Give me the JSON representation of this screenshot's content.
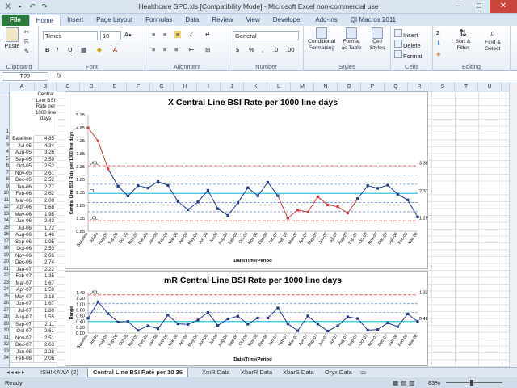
{
  "window": {
    "title": "Healthcare SPC.xls  [Compatibility Mode]  -  Microsoft Excel non-commercial use"
  },
  "tabs": [
    "File",
    "Home",
    "Insert",
    "Page Layout",
    "Formulas",
    "Data",
    "Review",
    "View",
    "Developer",
    "Add-Ins",
    "QI Macros 2011"
  ],
  "ribbon": {
    "paste": "Paste",
    "clipboard": "Clipboard",
    "font_name": "Times",
    "font_size": "10",
    "font": "Font",
    "alignment": "Alignment",
    "number_format": "General",
    "number": "Number",
    "cond_fmt": "Conditional Formatting",
    "format_table": "Format as Table",
    "cell_styles": "Cell Styles",
    "styles": "Styles",
    "insert": "Insert",
    "delete": "Delete",
    "format": "Format",
    "cells": "Cells",
    "sort_filter": "Sort & Filter",
    "find_select": "Find & Select",
    "editing": "Editing",
    "currency": "$",
    "percent": "%",
    "comma": ",",
    "dec_inc": ".0",
    "dec_dec": ".00"
  },
  "formula": {
    "namebox": "T22",
    "fx": "fx"
  },
  "columns": [
    "A",
    "B",
    "C",
    "D",
    "E",
    "F",
    "G",
    "H",
    "I",
    "J",
    "K",
    "L",
    "M",
    "N",
    "O",
    "P",
    "Q",
    "R",
    "S",
    "T",
    "U"
  ],
  "colB_header": "Central Line BSI Rate per 1000 line days",
  "rows": [
    [
      "Baseline",
      "4.85"
    ],
    [
      "Jul-05",
      "4.34"
    ],
    [
      "Aug-05",
      "3.26"
    ],
    [
      "Sep-05",
      "2.59"
    ],
    [
      "Oct-05",
      "2.52"
    ],
    [
      "Nov-05",
      "2.61"
    ],
    [
      "Dec-05",
      "2.52"
    ],
    [
      "Jan-06",
      "2.77"
    ],
    [
      "Feb-06",
      "2.62"
    ],
    [
      "Mar-06",
      "2.00"
    ],
    [
      "Apr-06",
      "1.68"
    ],
    [
      "May-06",
      "1.98"
    ],
    [
      "Jun-06",
      "2.43"
    ],
    [
      "Jul-06",
      "1.72"
    ],
    [
      "Aug-06",
      "1.46"
    ],
    [
      "Sep-06",
      "1.95"
    ],
    [
      "Oct-06",
      "2.53"
    ],
    [
      "Nov-06",
      "2.06"
    ],
    [
      "Dec-06",
      "2.74"
    ],
    [
      "Jan-07",
      "2.22"
    ],
    [
      "Feb-07",
      "1.35"
    ],
    [
      "Mar-07",
      "1.67"
    ],
    [
      "Apr-07",
      "1.59"
    ],
    [
      "May-07",
      "2.18"
    ],
    [
      "Jun-07",
      "1.67"
    ],
    [
      "Jul-07",
      "1.80"
    ],
    [
      "Aug-07",
      "1.55"
    ],
    [
      "Sep-07",
      "2.11"
    ],
    [
      "Oct-07",
      "2.61"
    ],
    [
      "Nov-07",
      "2.51"
    ],
    [
      "Dec-07",
      "2.63"
    ],
    [
      "Jan-08",
      "2.28"
    ],
    [
      "Feb-08",
      "2.06"
    ]
  ],
  "chart_data": [
    {
      "type": "line",
      "title": "X Central Line BSI Rate per 1000 line days",
      "xlabel": "Date/Time/Period",
      "ylabel": "Central Line BSI Rate per 1000 line days",
      "categories": [
        "Baseline",
        "Jul-05",
        "Aug-05",
        "Sep-05",
        "Oct-05",
        "Nov-05",
        "Dec-05",
        "Jan-06",
        "Feb-06",
        "Mar-06",
        "Apr-06",
        "May-06",
        "Jun-06",
        "Jul-06",
        "Aug-06",
        "Sep-06",
        "Oct-06",
        "Nov-06",
        "Dec-06",
        "Jan-07",
        "Feb-07",
        "Mar-07",
        "Apr-07",
        "May-07",
        "Jun-07",
        "Jul-07",
        "Aug-07",
        "Sep-07",
        "Oct-07",
        "Nov-07",
        "Dec-07",
        "Jan-08",
        "Feb-08",
        "Mar-08"
      ],
      "values": [
        4.85,
        4.34,
        3.26,
        2.59,
        2.21,
        2.61,
        2.52,
        2.77,
        2.62,
        2.0,
        1.68,
        1.98,
        2.43,
        1.72,
        1.46,
        1.95,
        2.53,
        2.22,
        2.74,
        2.22,
        1.35,
        1.67,
        1.59,
        2.18,
        1.87,
        1.8,
        1.55,
        2.11,
        2.61,
        2.51,
        2.63,
        2.28,
        2.06,
        1.4
      ],
      "yticks": [
        "0.85",
        "1.35",
        "1.85",
        "2.35",
        "2.85",
        "3.35",
        "3.85",
        "4.35",
        "4.85",
        "5.35"
      ],
      "ylim": [
        0.85,
        5.35
      ],
      "ucl": 3.38,
      "cl": 2.31,
      "lcl": 1.25,
      "ucl_label": "UCL",
      "cl_label": "CL",
      "lcl_label": "LCL",
      "ucl_text": "3.38",
      "cl_text": "2.31",
      "lcl_text": "1.25"
    },
    {
      "type": "line",
      "title": "mR Central Line BSI Rate per 1000 line days",
      "xlabel": "Date/Time/Period",
      "ylabel": "Range",
      "categories": [
        "Baseline",
        "Jul-05",
        "Aug-05",
        "Sep-05",
        "Oct-05",
        "Nov-05",
        "Dec-05",
        "Jan-06",
        "Feb-06",
        "Mar-06",
        "Apr-06",
        "May-06",
        "Jun-06",
        "Jul-06",
        "Aug-06",
        "Sep-06",
        "Oct-06",
        "Nov-06",
        "Dec-06",
        "Jan-07",
        "Feb-07",
        "Mar-07",
        "Apr-07",
        "May-07",
        "Jun-07",
        "Jul-07",
        "Aug-07",
        "Sep-07",
        "Oct-07",
        "Nov-07",
        "Dec-07",
        "Jan-08",
        "Feb-08",
        "Mar-08"
      ],
      "values": [
        0.51,
        1.08,
        0.67,
        0.38,
        0.4,
        0.09,
        0.25,
        0.15,
        0.62,
        0.32,
        0.3,
        0.45,
        0.71,
        0.26,
        0.49,
        0.58,
        0.31,
        0.52,
        0.52,
        0.87,
        0.32,
        0.08,
        0.59,
        0.31,
        0.07,
        0.25,
        0.56,
        0.5,
        0.1,
        0.12,
        0.35,
        0.22,
        0.66,
        0.4
      ],
      "yticks": [
        "0.00",
        "0.20",
        "0.40",
        "0.60",
        "0.80",
        "1.00",
        "1.20",
        "1.40"
      ],
      "ylim": [
        0,
        1.4
      ],
      "ucl": 1.32,
      "cl": 0.4,
      "ucl_label": "UCL",
      "ucl_text": "1.32",
      "cl_text": "0.40"
    }
  ],
  "sheets": [
    "ISHIKAWA (2)",
    "Central Line BSI Rate per 10 36",
    "XmR Data",
    "XbarR Data",
    "XbarS Data",
    "Oryx Data"
  ],
  "status": {
    "ready": "Ready",
    "zoom": "83%"
  }
}
